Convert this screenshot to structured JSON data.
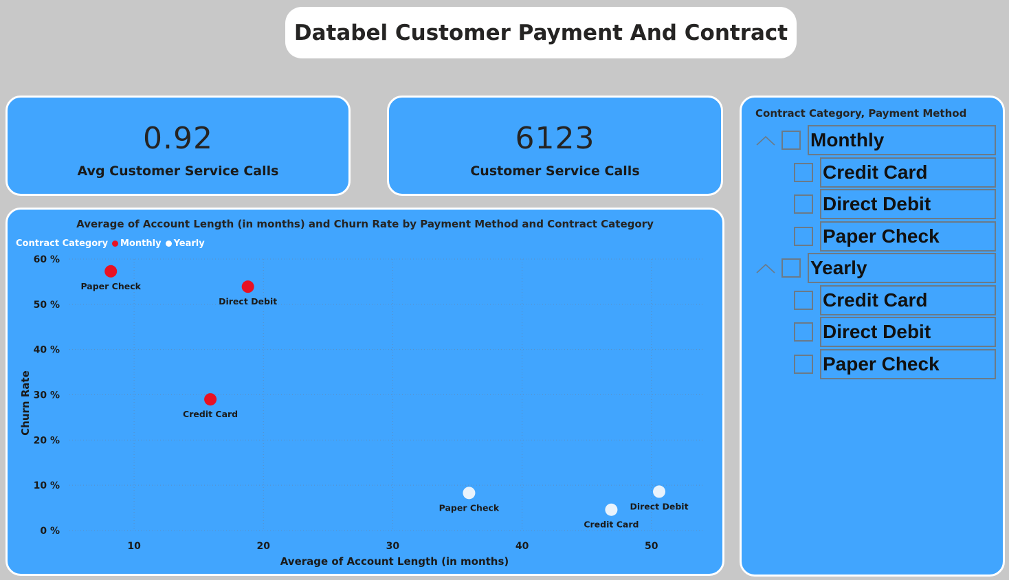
{
  "header": {
    "title": "Databel Customer Payment And Contract"
  },
  "kpis": [
    {
      "value": "0.92",
      "label": "Avg Customer Service Calls"
    },
    {
      "value": "6123",
      "label": "Customer Service Calls"
    }
  ],
  "colors": {
    "monthly": "#e81123",
    "yearly": "#e9f3fc",
    "panel": "#41a5fe",
    "background": "#c8c8c8"
  },
  "chart_data": {
    "type": "scatter",
    "title": "Average of Account Length (in months) and Churn Rate by Payment Method and Contract Category",
    "xlabel": "Average of Account Length (in months)",
    "ylabel": "Churn Rate",
    "xlim": [
      5,
      54
    ],
    "ylim": [
      0,
      60
    ],
    "xticks": [
      10,
      20,
      30,
      40,
      50
    ],
    "yticks": [
      0,
      10,
      20,
      30,
      40,
      50,
      60
    ],
    "ytick_labels": [
      "0 %",
      "10 %",
      "20 %",
      "30 %",
      "40 %",
      "50 %",
      "60 %"
    ],
    "legend_title": "Contract Category",
    "legend_position": "top-left",
    "grid": true,
    "series": [
      {
        "name": "Monthly",
        "points": [
          {
            "label": "Paper Check",
            "x": 8.2,
            "y": 57.3
          },
          {
            "label": "Direct Debit",
            "x": 18.8,
            "y": 53.9
          },
          {
            "label": "Credit Card",
            "x": 15.9,
            "y": 29.0
          }
        ]
      },
      {
        "name": "Yearly",
        "points": [
          {
            "label": "Paper Check",
            "x": 35.9,
            "y": 8.3
          },
          {
            "label": "Credit Card",
            "x": 46.9,
            "y": 4.6
          },
          {
            "label": "Direct Debit",
            "x": 50.6,
            "y": 8.6
          }
        ]
      }
    ]
  },
  "slicer": {
    "header": "Contract Category, Payment Method",
    "groups": [
      {
        "label": "Monthly",
        "items": [
          "Credit Card",
          "Direct Debit",
          "Paper Check"
        ]
      },
      {
        "label": "Yearly",
        "items": [
          "Credit Card",
          "Direct Debit",
          "Paper Check"
        ]
      }
    ]
  }
}
